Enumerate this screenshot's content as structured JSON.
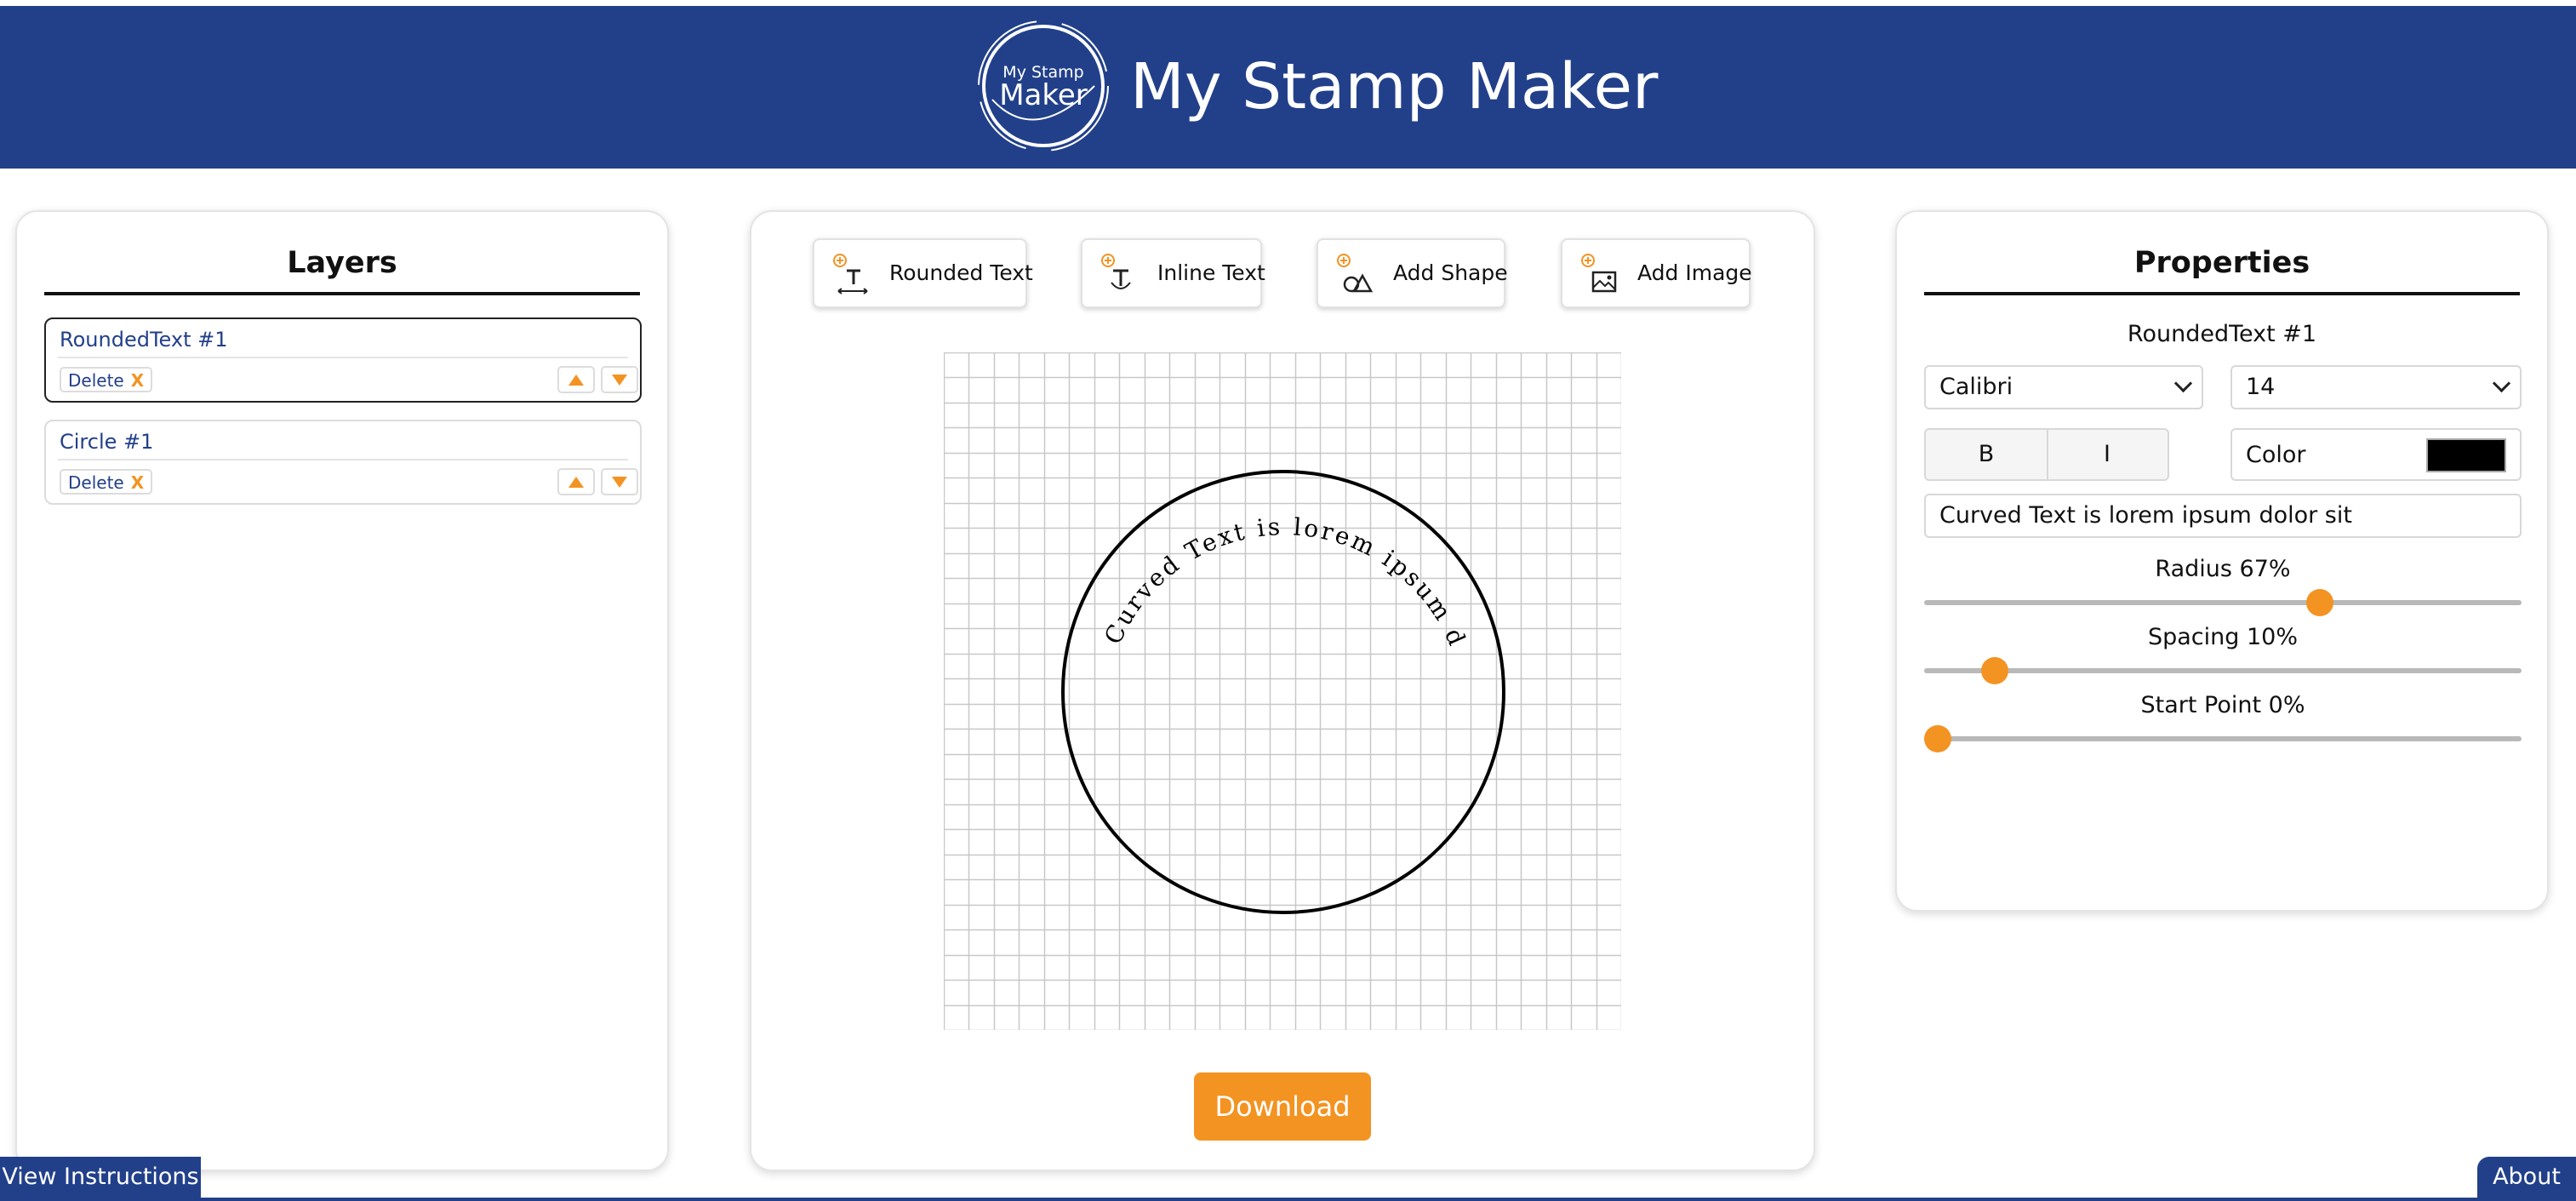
{
  "header": {
    "logo_line1": "My Stamp",
    "logo_line2": "Maker",
    "title": "My Stamp Maker"
  },
  "layers_panel": {
    "title": "Layers",
    "items": [
      {
        "name": "RoundedText #1",
        "delete_label": "Delete",
        "delete_x": "X"
      },
      {
        "name": "Circle #1",
        "delete_label": "Delete",
        "delete_x": "X"
      }
    ]
  },
  "toolbar": {
    "buttons": [
      {
        "label": "Rounded Text",
        "icon": "rounded-text-icon"
      },
      {
        "label": "Inline Text",
        "icon": "inline-text-icon"
      },
      {
        "label": "Add Shape",
        "icon": "add-shape-icon"
      },
      {
        "label": "Add Image",
        "icon": "add-image-icon"
      }
    ]
  },
  "canvas": {
    "curved_text": "Curved Text is lorem ipsum dolor sit",
    "download_label": "Download"
  },
  "properties": {
    "title": "Properties",
    "selected_layer": "RoundedText #1",
    "font_family": "Calibri",
    "font_size": "14",
    "bold_label": "B",
    "italic_label": "I",
    "color_label": "Color",
    "color_value": "#000000",
    "text_value": "Curved Text is lorem ipsum dolor sit",
    "radius": {
      "label": "Radius 67%",
      "value": 67
    },
    "spacing": {
      "label": "Spacing 10%",
      "value": 10
    },
    "start_point": {
      "label": "Start Point 0%",
      "value": 0
    }
  },
  "footer": {
    "instructions_label": "View Instructions",
    "about_label": "About"
  },
  "colors": {
    "brand_blue": "#22408a",
    "accent_orange": "#f39322"
  }
}
